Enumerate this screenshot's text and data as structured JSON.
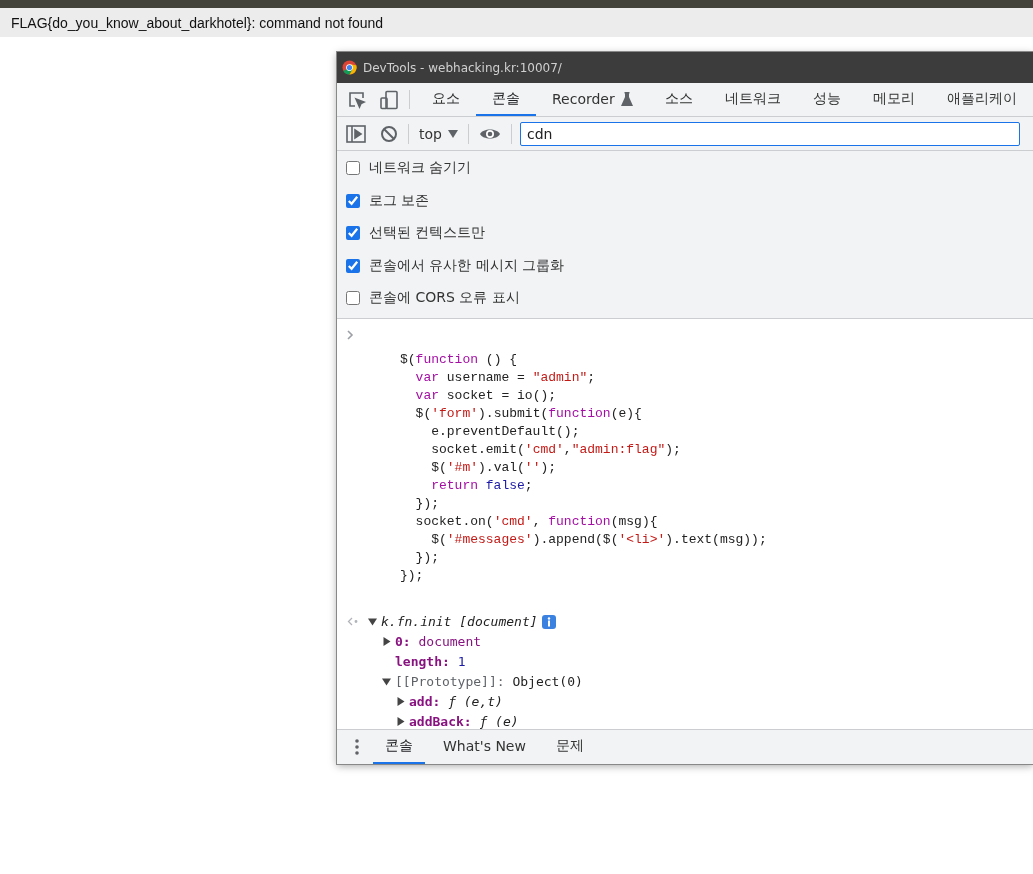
{
  "page": {
    "message": "FLAG{do_you_know_about_darkhotel}: command not found"
  },
  "window": {
    "title": "DevTools - webhacking.kr:10007/"
  },
  "tabs": [
    {
      "label": "요소",
      "selected": false,
      "experimental": false
    },
    {
      "label": "콘솔",
      "selected": true,
      "experimental": false
    },
    {
      "label": "Recorder",
      "selected": false,
      "experimental": true
    },
    {
      "label": "소스",
      "selected": false,
      "experimental": false
    },
    {
      "label": "네트워크",
      "selected": false,
      "experimental": false
    },
    {
      "label": "성능",
      "selected": false,
      "experimental": false
    },
    {
      "label": "메모리",
      "selected": false,
      "experimental": false
    },
    {
      "label": "애플리케이",
      "selected": false,
      "experimental": false
    }
  ],
  "toolbar": {
    "context": "top",
    "filter": {
      "value": "cdn"
    }
  },
  "settings": [
    {
      "label": "네트워크 숨기기",
      "checked": false
    },
    {
      "label": "로그 보존",
      "checked": true
    },
    {
      "label": "선택된 컨텍스트만",
      "checked": true
    },
    {
      "label": "콘솔에서 유사한 메시지 그룹화",
      "checked": true
    },
    {
      "label": "콘솔에 CORS 오류 표시",
      "checked": false
    }
  ],
  "console": {
    "code": [
      [
        {
          "kind": "plain",
          "text": "$("
        },
        {
          "kind": "keyword",
          "text": "function"
        },
        {
          "kind": "plain",
          "text": " () {"
        }
      ],
      [
        {
          "kind": "keyword",
          "text": "  var"
        },
        {
          "kind": "plain",
          "text": " username = "
        },
        {
          "kind": "string",
          "text": "\"admin\""
        },
        {
          "kind": "plain",
          "text": ";"
        }
      ],
      [
        {
          "kind": "keyword",
          "text": "  var"
        },
        {
          "kind": "plain",
          "text": " socket = io();"
        }
      ],
      [
        {
          "kind": "plain",
          "text": "  $("
        },
        {
          "kind": "string",
          "text": "'form'"
        },
        {
          "kind": "plain",
          "text": ").submit("
        },
        {
          "kind": "keyword",
          "text": "function"
        },
        {
          "kind": "plain",
          "text": "(e){"
        }
      ],
      [
        {
          "kind": "plain",
          "text": "    e.preventDefault();"
        }
      ],
      [
        {
          "kind": "plain",
          "text": "    socket.emit("
        },
        {
          "kind": "string",
          "text": "'cmd'"
        },
        {
          "kind": "plain",
          "text": ","
        },
        {
          "kind": "string",
          "text": "\"admin:flag\""
        },
        {
          "kind": "plain",
          "text": ");"
        }
      ],
      [
        {
          "kind": "plain",
          "text": "    $("
        },
        {
          "kind": "string",
          "text": "'#m'"
        },
        {
          "kind": "plain",
          "text": ").val("
        },
        {
          "kind": "string",
          "text": "''"
        },
        {
          "kind": "plain",
          "text": ");"
        }
      ],
      [
        {
          "kind": "keyword",
          "text": "    return"
        },
        {
          "kind": "atom",
          "text": " false"
        },
        {
          "kind": "plain",
          "text": ";"
        }
      ],
      [
        {
          "kind": "plain",
          "text": "  });"
        }
      ],
      [
        {
          "kind": "plain",
          "text": "  socket.on("
        },
        {
          "kind": "string",
          "text": "'cmd'"
        },
        {
          "kind": "plain",
          "text": ", "
        },
        {
          "kind": "keyword",
          "text": "function"
        },
        {
          "kind": "plain",
          "text": "(msg){"
        }
      ],
      [
        {
          "kind": "plain",
          "text": "    $("
        },
        {
          "kind": "string",
          "text": "'#messages'"
        },
        {
          "kind": "plain",
          "text": ").append($("
        },
        {
          "kind": "string",
          "text": "'<li>'"
        },
        {
          "kind": "plain",
          "text": ").text(msg));"
        }
      ],
      [
        {
          "kind": "plain",
          "text": "  });"
        }
      ],
      [
        {
          "kind": "plain",
          "text": "});"
        }
      ]
    ],
    "result": {
      "label": "k.fn.init [document]",
      "expanded": true,
      "children": [
        {
          "kind": "node",
          "key": "0:",
          "value": "document",
          "expanded": false
        },
        {
          "kind": "number",
          "key": "length:",
          "value": "1"
        },
        {
          "kind": "internal",
          "key": "[[Prototype]]:",
          "value": "Object(0)",
          "expanded": true,
          "children": [
            {
              "kind": "function",
              "key": "add:",
              "value": "ƒ (e,t)",
              "expanded": false
            },
            {
              "kind": "function",
              "key": "addBack:",
              "value": "ƒ (e)",
              "expanded": false
            }
          ]
        }
      ]
    }
  },
  "drawer_tabs": [
    {
      "label": "콘솔",
      "selected": true
    },
    {
      "label": "What's New",
      "selected": false
    },
    {
      "label": "문제",
      "selected": false
    }
  ]
}
